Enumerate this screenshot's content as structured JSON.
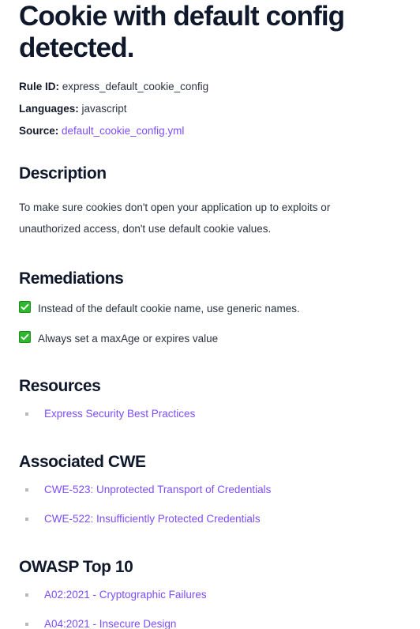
{
  "title": "Cookie with default config detected.",
  "meta": {
    "rule_id": {
      "label": "Rule ID:",
      "value": "express_default_cookie_config"
    },
    "languages": {
      "label": "Languages:",
      "value": "javascript"
    },
    "source": {
      "label": "Source:",
      "value": "default_cookie_config.yml"
    }
  },
  "sections": {
    "description": {
      "heading": "Description",
      "body": "To make sure cookies don't open your application up to exploits or unauthorized access, don't use default cookie values."
    },
    "remediations": {
      "heading": "Remediations",
      "items": [
        {
          "icon": "green-check-icon",
          "text": "Instead of the default cookie name, use generic names."
        },
        {
          "icon": "green-check-icon",
          "text": "Always set a maxAge or expires value"
        }
      ]
    },
    "resources": {
      "heading": "Resources",
      "items": [
        {
          "text": "Express Security Best Practices"
        }
      ]
    },
    "associated_cwe": {
      "heading": "Associated CWE",
      "items": [
        {
          "text": "CWE-523: Unprotected Transport of Credentials"
        },
        {
          "text": "CWE-522: Insufficiently Protected Credentials"
        }
      ]
    },
    "owasp_top_10": {
      "heading": "OWASP Top 10",
      "items": [
        {
          "text": "A02:2021 - Cryptographic Failures"
        },
        {
          "text": "A04:2021 - Insecure Design"
        }
      ]
    }
  },
  "colors": {
    "link": "#7c4dff",
    "heading": "#10182b",
    "body_text": "#2b3240",
    "check_green": "#2eb82e",
    "bullet_gray": "#b8b9bd"
  }
}
